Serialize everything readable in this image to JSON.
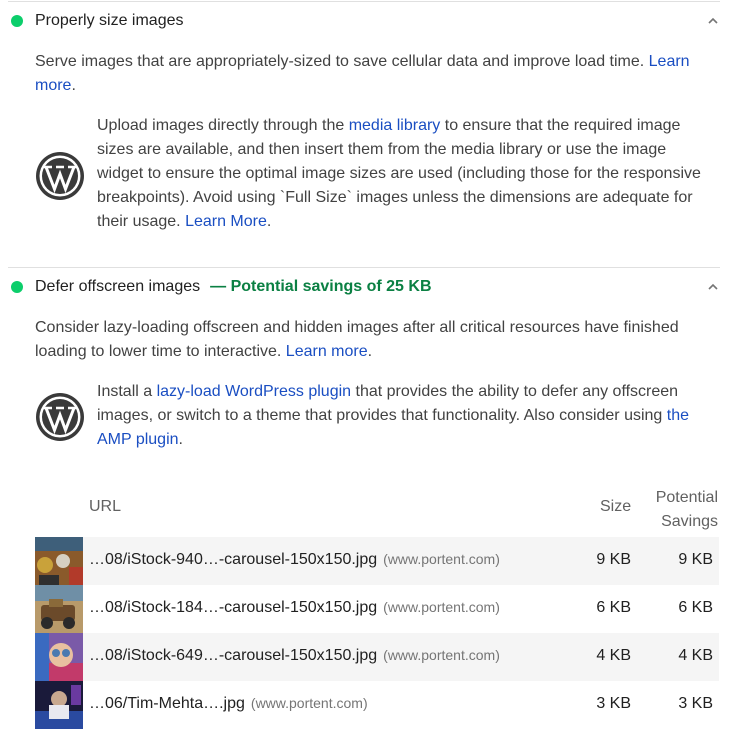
{
  "colors": {
    "pass": "#0cce6b",
    "savings": "#0b8043",
    "link": "#1a4ec2"
  },
  "audits": [
    {
      "title": "Properly size images",
      "description": "Serve images that are appropriately-sized to save cellular data and improve load time. ",
      "learn_more": "Learn more",
      "stack_pre": "Upload images directly through the ",
      "stack_link": "media library",
      "stack_post": " to ensure that the required image sizes are available, and then insert them from the media library or use the image widget to ensure the optimal image sizes are used (including those for the responsive breakpoints). Avoid using `Full Size` images unless the dimensions are adequate for their usage. ",
      "stack_learn_more": "Learn More"
    },
    {
      "title": "Defer offscreen images",
      "savings": "— Potential savings of 25 KB",
      "description": "Consider lazy-loading offscreen and hidden images after all critical resources have finished loading to lower time to interactive. ",
      "learn_more": "Learn more",
      "stack_pre": "Install a ",
      "stack_link": "lazy-load WordPress plugin",
      "stack_mid": " that provides the ability to defer any offscreen images, or switch to a theme that provides that functionality. Also consider using ",
      "stack_link2": "the AMP plugin",
      "stack_post": "."
    }
  ],
  "table": {
    "headers": {
      "url": "URL",
      "size": "Size",
      "savings_line1": "Potential",
      "savings_line2": "Savings"
    },
    "rows": [
      {
        "url": "…08/iStock-940…-carousel-150x150.jpg",
        "origin": "(www.portent.com)",
        "size": "9 KB",
        "savings": "9 KB"
      },
      {
        "url": "…08/iStock-184…-carousel-150x150.jpg",
        "origin": "(www.portent.com)",
        "size": "6 KB",
        "savings": "6 KB"
      },
      {
        "url": "…08/iStock-649…-carousel-150x150.jpg",
        "origin": "(www.portent.com)",
        "size": "4 KB",
        "savings": "4 KB"
      },
      {
        "url": "…06/Tim-Mehta….jpg",
        "origin": "(www.portent.com)",
        "size": "3 KB",
        "savings": "3 KB"
      }
    ]
  },
  "icons": {
    "expand": "chevron-up-icon",
    "stack": "wordpress-icon"
  }
}
